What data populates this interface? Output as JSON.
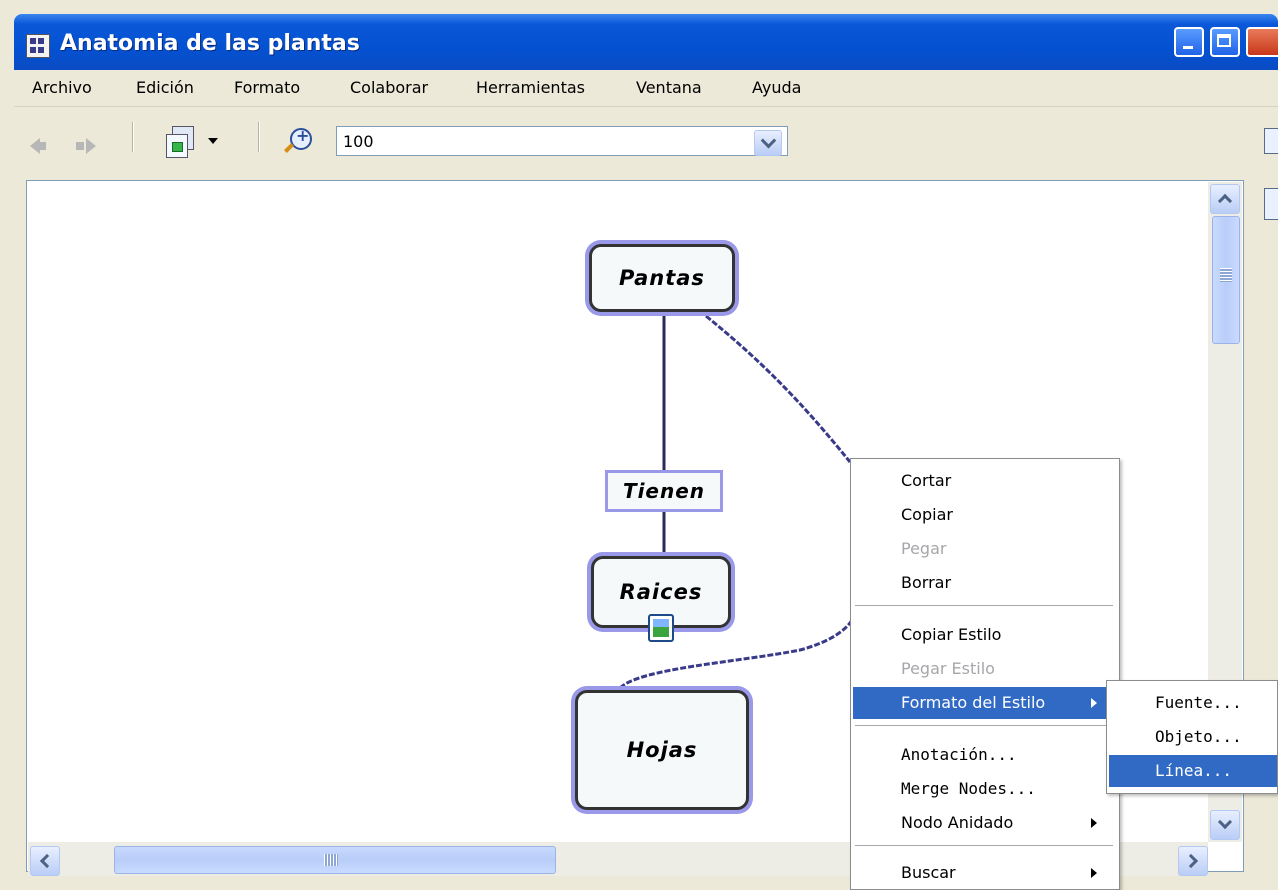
{
  "window": {
    "title": "Anatomia de las plantas"
  },
  "menubar": {
    "items": [
      "Archivo",
      "Edición",
      "Formato",
      "Colaborar",
      "Herramientas",
      "Ventana",
      "Ayuda"
    ]
  },
  "toolbar": {
    "zoom_value": "100"
  },
  "concept_map": {
    "nodes": {
      "pantas": "Pantas",
      "tienen": "Tienen",
      "raices": "Raices",
      "hojas": "Hojas"
    }
  },
  "context_menu": {
    "items": [
      {
        "label": "Cortar",
        "enabled": true
      },
      {
        "label": "Copiar",
        "enabled": true
      },
      {
        "label": "Pegar",
        "enabled": false
      },
      {
        "label": "Borrar",
        "enabled": true
      },
      {
        "label": "Copiar Estilo",
        "enabled": true
      },
      {
        "label": "Pegar Estilo",
        "enabled": false
      },
      {
        "label": "Formato del Estilo",
        "enabled": true,
        "highlighted": true,
        "submenu": true
      },
      {
        "label": "Anotación...",
        "enabled": true
      },
      {
        "label": "Merge Nodes...",
        "enabled": true
      },
      {
        "label": "Nodo Anidado",
        "enabled": true,
        "submenu": true
      },
      {
        "label": "Buscar",
        "enabled": true,
        "submenu": true
      }
    ]
  },
  "submenu": {
    "items": [
      {
        "label": "Fuente..."
      },
      {
        "label": "Objeto..."
      },
      {
        "label": "Línea...",
        "highlighted": true
      }
    ]
  },
  "colors": {
    "titlebar": "#0451d2",
    "highlight": "#316ac5",
    "node_border": "#9a98e8",
    "connector": "#3a3a8a"
  }
}
